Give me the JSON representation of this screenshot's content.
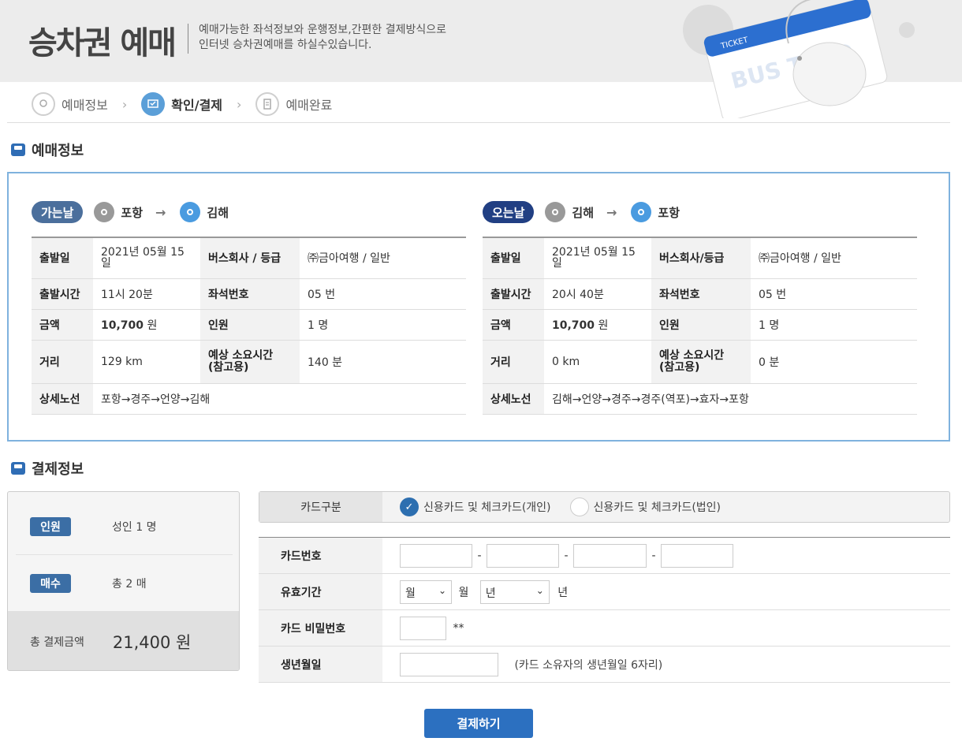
{
  "header": {
    "title": "승차권 예매",
    "desc_line1": "예매가능한 좌석정보와 운행정보,간편한 결제방식으로",
    "desc_line2": "인터넷 승차권예매를 하실수있습니다.",
    "ticket_label": "TICKET",
    "ticket_brand": "BUS TAGO"
  },
  "steps": [
    {
      "label": "예매정보",
      "icon": "location-icon",
      "active": false
    },
    {
      "label": "확인/결제",
      "icon": "monitor-check-icon",
      "active": true
    },
    {
      "label": "예매완료",
      "icon": "document-icon",
      "active": false
    }
  ],
  "reservation": {
    "section_title": "예매정보",
    "outbound": {
      "badge": "가는날",
      "from": "포항",
      "to": "김해",
      "rows": {
        "depart_date_label": "출발일",
        "depart_date": "2021년 05월 15일",
        "company_label": "버스회사 / 등급",
        "company": "㈜금아여행 / 일반",
        "depart_time_label": "출발시간",
        "depart_time": "11시 20분",
        "seat_label": "좌석번호",
        "seat": "05 번",
        "price_label": "금액",
        "price": "10,700",
        "price_unit": "원",
        "people_label": "인원",
        "people": "1 명",
        "distance_label": "거리",
        "distance": "129 km",
        "duration_label": "예상 소요시간 (참고용)",
        "duration": "140 분",
        "route_label": "상세노선",
        "route": "포항→경주→언양→김해"
      }
    },
    "inbound": {
      "badge": "오는날",
      "from": "김해",
      "to": "포항",
      "rows": {
        "depart_date_label": "출발일",
        "depart_date": "2021년 05월 15일",
        "company_label": "버스회사/등급",
        "company": "㈜금아여행 / 일반",
        "depart_time_label": "출발시간",
        "depart_time": "20시 40분",
        "seat_label": "좌석번호",
        "seat": "05 번",
        "price_label": "금액",
        "price": "10,700",
        "price_unit": "원",
        "people_label": "인원",
        "people": "1 명",
        "distance_label": "거리",
        "distance": "0 km",
        "duration_label": "예상 소요시간 (참고용)",
        "duration": "0 분",
        "route_label": "상세노선",
        "route": "김해→언양→경주→경주(역포)→효자→포항"
      }
    }
  },
  "payment": {
    "section_title": "결제정보",
    "summary": {
      "people_badge": "인원",
      "people_value": "성인 1 명",
      "tickets_badge": "매수",
      "tickets_value": "총 2 매",
      "total_label": "총 결제금액",
      "total_value": "21,400 원"
    },
    "card_type_label": "카드구분",
    "card_options": [
      "신용카드 및 체크카드(개인)",
      "신용카드 및 체크카드(법인)"
    ],
    "card_number_label": "카드번호",
    "expiry_label": "유효기간",
    "month_select": "월",
    "month_unit": "월",
    "year_select": "년",
    "year_unit": "년",
    "password_label": "카드 비밀번호",
    "password_suffix": "**",
    "birth_label": "생년월일",
    "birth_hint": "(카드 소유자의 생년월일 6자리)",
    "submit_label": "결제하기"
  },
  "colors": {
    "accent": "#2c70c0",
    "outbound_badge": "#4b6f9c",
    "inbound_badge": "#213f83",
    "box_border": "#7fb2de"
  }
}
